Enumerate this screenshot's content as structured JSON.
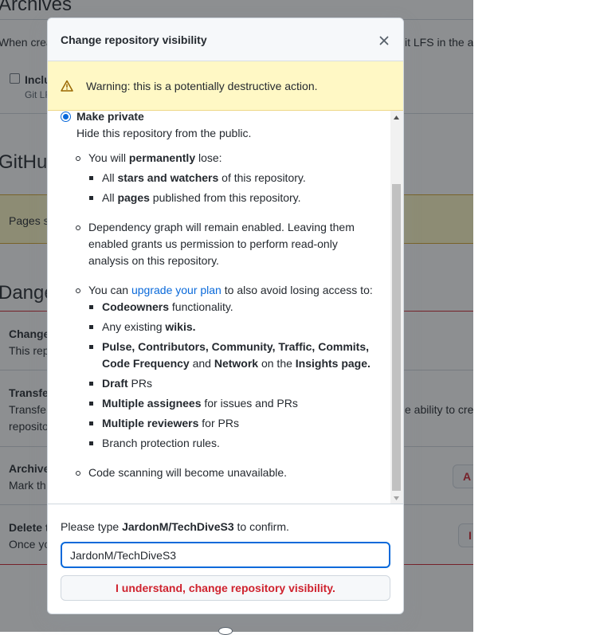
{
  "background": {
    "archives_heading": "Archives",
    "archives_desc_left": "When crea",
    "archives_desc_right": "it LFS in the ar",
    "include_label": "Inclu",
    "include_sub": "Git LF",
    "github_heading": "GitHul",
    "pages_notice": "Pages s",
    "danger_heading": "Dange",
    "change_title": "Change",
    "change_desc": "This rep",
    "transfer_title": "Transfe",
    "transfer_desc1": "Transfe",
    "transfer_desc2": "reposito",
    "transfer_desc_right": "e ability to crea",
    "archive_title": "Archive",
    "archive_desc": "Mark th",
    "archive_btn": "A",
    "delete_title": "Delete t",
    "delete_desc": "Once yo",
    "delete_btn": "I"
  },
  "modal": {
    "title": "Change repository visibility",
    "warning": "Warning: this is a potentially destructive action.",
    "radio_label": "Make private",
    "radio_desc": "Hide this repository from the public.",
    "items": {
      "lose_prefix": "You will ",
      "lose_bold": "permanently",
      "lose_suffix": " lose:",
      "lose_1_prefix": "All ",
      "lose_1_bold": "stars and watchers",
      "lose_1_suffix": " of this repository.",
      "lose_2_prefix": "All ",
      "lose_2_bold": "pages",
      "lose_2_suffix": " published from this repository.",
      "dep_line1": "Dependency graph will remain enabled. Leaving them",
      "dep_line2": "enabled grants us permission to perform read-only",
      "dep_line3": "analysis on this repository.",
      "upgrade_prefix": "You can ",
      "upgrade_link": "upgrade your plan",
      "upgrade_suffix": " to also avoid losing access to:",
      "u1_bold": "Codeowners",
      "u1_suffix": " functionality.",
      "u2_prefix": "Any existing ",
      "u2_bold": "wikis.",
      "u3_line1": "Pulse, Contributors, Community, Traffic, Commits,",
      "u3_l2_b1": "Code Frequency",
      "u3_l2_t1": " and ",
      "u3_l2_b2": "Network",
      "u3_l2_t2": " on the ",
      "u3_l2_b3": "Insights page.",
      "u4_bold": "Draft",
      "u4_suffix": " PRs",
      "u5_bold": "Multiple assignees",
      "u5_suffix": " for issues and PRs",
      "u6_bold": "Multiple reviewers",
      "u6_suffix": " for PRs",
      "u7": "Branch protection rules.",
      "code_scanning": "Code scanning will become unavailable."
    },
    "confirm_prefix": "Please type ",
    "confirm_repo": "JardonM/TechDiveS3",
    "confirm_suffix": " to confirm.",
    "input_value": "JardonM/TechDiveS3",
    "confirm_button": "I understand, change repository visibility."
  },
  "colors": {
    "accent": "#0969da",
    "danger": "#cf222e",
    "warning_bg": "#fff8c5",
    "warning_icon": "#9a6700"
  },
  "icons": {
    "close": "close-icon",
    "warning": "alert-icon"
  }
}
